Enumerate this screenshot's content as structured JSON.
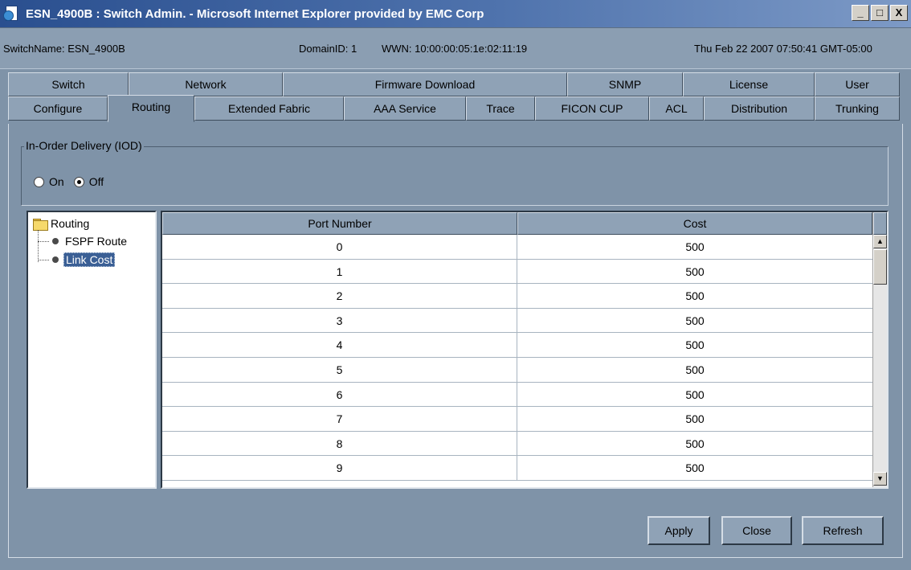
{
  "window": {
    "title": "ESN_4900B : Switch Admin. - Microsoft Internet Explorer provided by EMC Corp",
    "buttons": {
      "minimize": "_",
      "maximize": "□",
      "close": "X"
    }
  },
  "info": {
    "switch_name": "SwitchName: ESN_4900B",
    "domain_id": "DomainID: 1",
    "wwn": "WWN: 10:00:00:05:1e:02:11:19",
    "datetime": "Thu Feb 22 2007 07:50:41 GMT-05:00"
  },
  "tabs": {
    "row1": [
      "Switch",
      "Network",
      "Firmware Download",
      "SNMP",
      "License",
      "User"
    ],
    "row2": [
      "Configure",
      "Routing",
      "Extended Fabric",
      "AAA Service",
      "Trace",
      "FICON CUP",
      "ACL",
      "Distribution",
      "Trunking"
    ],
    "active": "Routing"
  },
  "iod": {
    "legend": "In-Order Delivery (IOD)",
    "on_label": "On",
    "off_label": "Off",
    "selected": "Off"
  },
  "tree": {
    "root": "Routing",
    "items": [
      "FSPF Route",
      "Link Cost"
    ],
    "selected": "Link Cost"
  },
  "table": {
    "columns": [
      "Port Number",
      "Cost"
    ],
    "rows": [
      [
        "0",
        "500"
      ],
      [
        "1",
        "500"
      ],
      [
        "2",
        "500"
      ],
      [
        "3",
        "500"
      ],
      [
        "4",
        "500"
      ],
      [
        "5",
        "500"
      ],
      [
        "6",
        "500"
      ],
      [
        "7",
        "500"
      ],
      [
        "8",
        "500"
      ],
      [
        "9",
        "500"
      ]
    ]
  },
  "actions": {
    "apply": "Apply",
    "close": "Close",
    "refresh": "Refresh"
  }
}
